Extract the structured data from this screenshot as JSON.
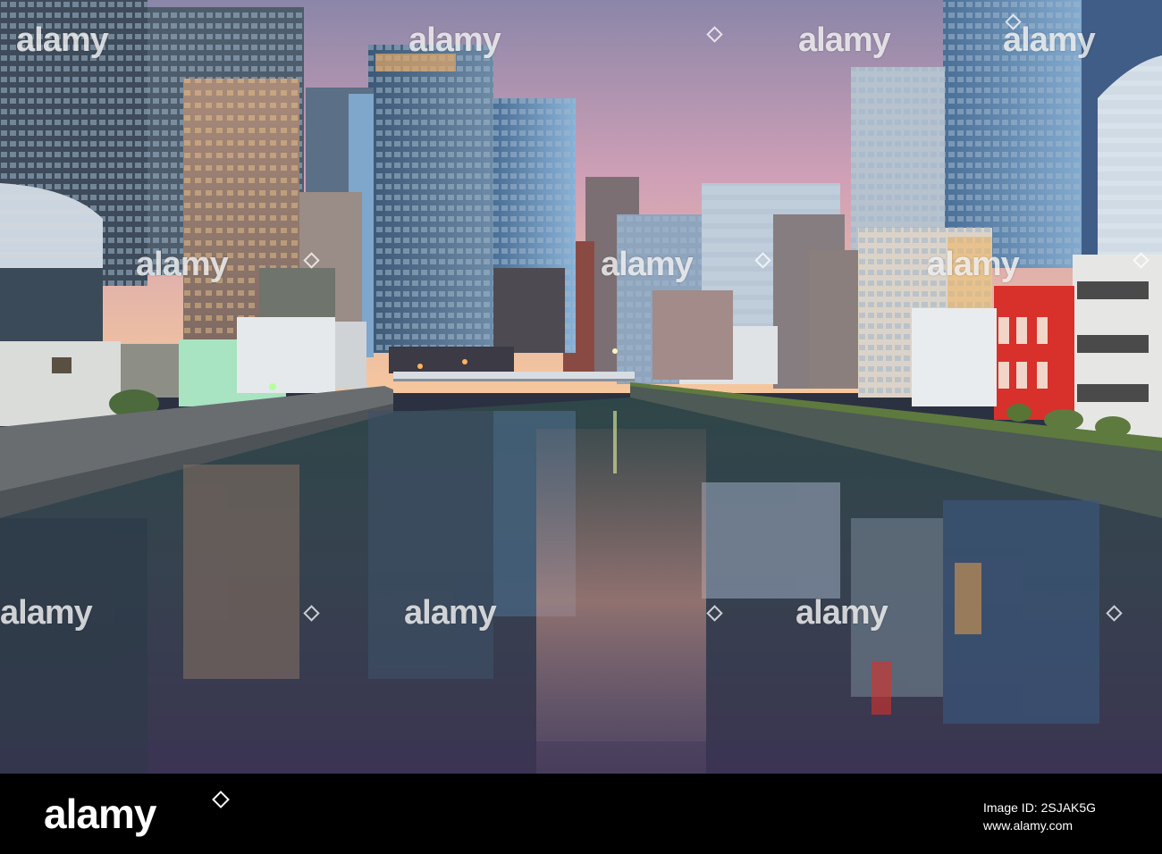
{
  "photo": {
    "subject": "Osaka city skyline reflected in a river canal at dusk",
    "colors": {
      "sky_top": "#8f86a8",
      "sky_mid": "#d7a2b6",
      "sky_glow": "#f4c49d",
      "water": "#2a3a40",
      "red_building": "#d8302b"
    }
  },
  "watermark": {
    "text": "alamy"
  },
  "footer": {
    "logo": "alamy",
    "line1": "Image ID: 2SJAK5G",
    "line2": "www.alamy.com",
    "image_id": "2SJAK5G"
  }
}
